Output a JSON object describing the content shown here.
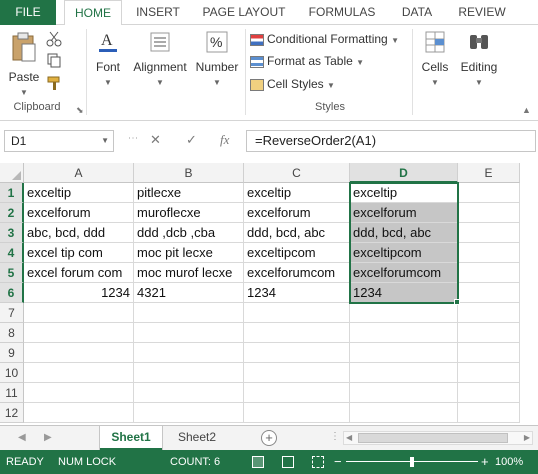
{
  "ribbon_tabs": [
    "FILE",
    "HOME",
    "INSERT",
    "PAGE LAYOUT",
    "FORMULAS",
    "DATA",
    "REVIEW"
  ],
  "ribbon": {
    "paste": "Paste",
    "clipboard": "Clipboard",
    "font": "Font",
    "alignment": "Alignment",
    "number": "Number",
    "conditional_formatting": "Conditional Formatting",
    "format_as_table": "Format as Table",
    "cell_styles": "Cell Styles",
    "styles": "Styles",
    "cells": "Cells",
    "editing": "Editing"
  },
  "formula_bar": {
    "name_box": "D1",
    "cancel_symbol": "✕",
    "enter_symbol": "✓",
    "fx": "fx",
    "formula": "=ReverseOrder2(A1)"
  },
  "columns": [
    "A",
    "B",
    "C",
    "D",
    "E"
  ],
  "rows": [
    "1",
    "2",
    "3",
    "4",
    "5",
    "6",
    "7",
    "8",
    "9",
    "10",
    "11",
    "12"
  ],
  "cells": [
    [
      "exceltip",
      "pitlecxe",
      "exceltip",
      "exceltip"
    ],
    [
      "excelforum",
      "muroflecxe",
      "excelforum",
      "excelforum"
    ],
    [
      "abc, bcd, ddd",
      "ddd ,dcb ,cba",
      "ddd, bcd, abc",
      "ddd, bcd, abc"
    ],
    [
      "excel tip com",
      "moc pit lecxe",
      "exceltipcom",
      "exceltipcom"
    ],
    [
      "excel forum com",
      "moc murof lecxe",
      "excelforumcom",
      "excelforumcom"
    ],
    [
      "1234",
      "4321",
      "1234",
      "1234"
    ]
  ],
  "sheets": [
    "Sheet1",
    "Sheet2"
  ],
  "add_sheet_symbol": "+",
  "status": {
    "mode": "READY",
    "num_lock": "NUM LOCK",
    "count": "COUNT: 6",
    "zoom": "100%"
  },
  "colors": {
    "accent": "#217346",
    "selection_shade": "#c6c6c6"
  }
}
